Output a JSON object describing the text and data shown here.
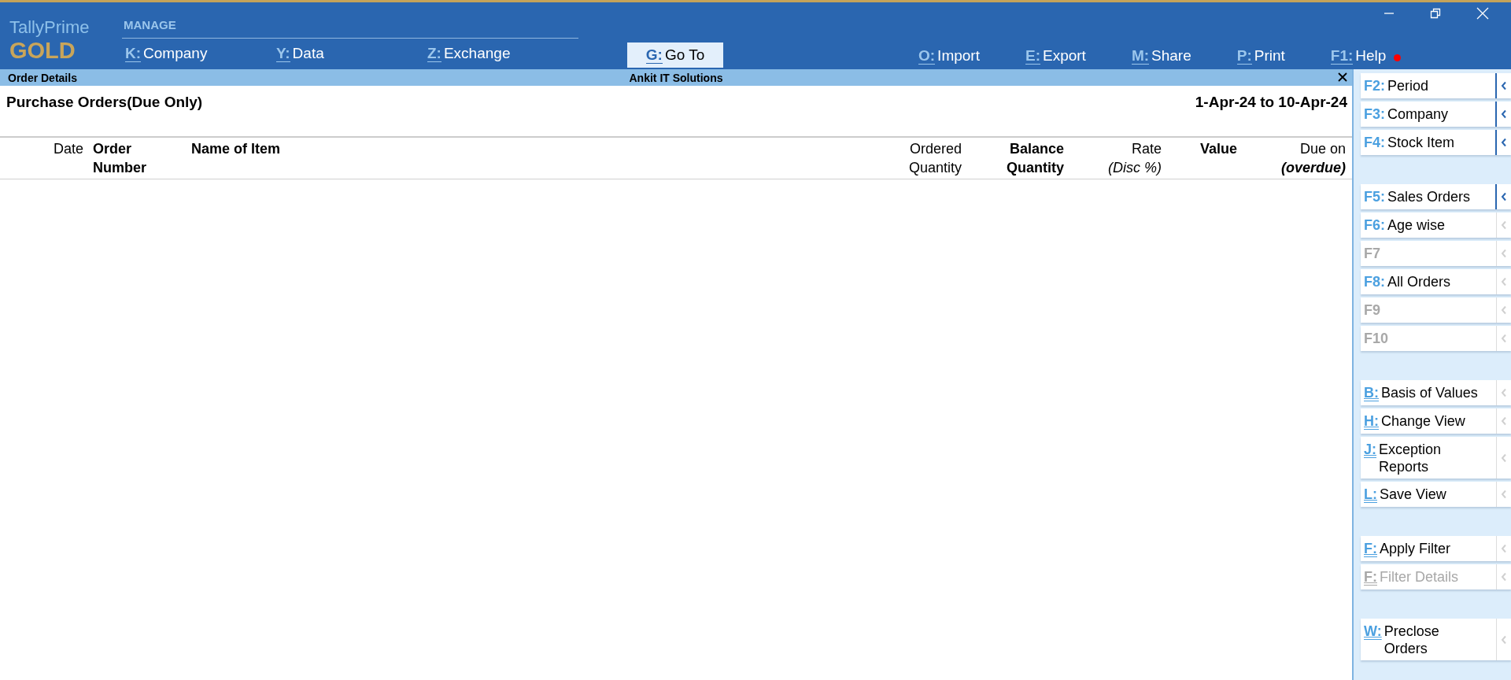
{
  "logo": {
    "product": "TallyPrime",
    "edition": "GOLD"
  },
  "manage": {
    "heading": "MANAGE",
    "items": [
      {
        "key": "K:",
        "label": "Company"
      },
      {
        "key": "Y:",
        "label": "Data"
      },
      {
        "key": "Z:",
        "label": "Exchange"
      }
    ]
  },
  "goto": {
    "key": "G:",
    "label": "Go To"
  },
  "actions": [
    {
      "key": "O:",
      "label": "Import",
      "alert": false
    },
    {
      "key": "E:",
      "label": "Export",
      "alert": false
    },
    {
      "key": "M:",
      "label": "Share",
      "alert": false
    },
    {
      "key": "P:",
      "label": "Print",
      "alert": false
    },
    {
      "key": "F1:",
      "label": "Help",
      "alert": true
    }
  ],
  "subtitle_bar": {
    "left": "Order Details",
    "center": "Ankit IT Solutions"
  },
  "report": {
    "title": "Purchase Orders(Due Only)",
    "period": "1-Apr-24 to 10-Apr-24"
  },
  "table": {
    "columns": [
      {
        "lines": [
          "Date"
        ]
      },
      {
        "lines": [
          "Order",
          "Number"
        ]
      },
      {
        "lines": [
          "Name of Item"
        ]
      },
      {
        "lines": [
          "Ordered",
          "Quantity"
        ]
      },
      {
        "lines": [
          "Balance",
          "Quantity"
        ]
      },
      {
        "lines": [
          "Rate",
          "*(Disc %)*"
        ]
      },
      {
        "lines": [
          "Value"
        ]
      },
      {
        "lines": [
          "Due on",
          "**(overdue)**"
        ]
      }
    ]
  },
  "sidebar": {
    "groups": [
      {
        "items": [
          {
            "key": "F2:",
            "label": "Period",
            "disabled": false,
            "underlined": false,
            "expandable": true
          },
          {
            "key": "F3:",
            "label": "Company",
            "disabled": false,
            "underlined": false,
            "expandable": true
          },
          {
            "key": "F4:",
            "label": "Stock Item",
            "disabled": false,
            "underlined": false,
            "expandable": true
          }
        ]
      },
      {
        "items": [
          {
            "key": "F5:",
            "label": "Sales Orders",
            "disabled": false,
            "underlined": false,
            "expandable": true
          },
          {
            "key": "F6:",
            "label": "Age wise",
            "disabled": false,
            "underlined": false,
            "expandable": false
          },
          {
            "key": "F7",
            "disabled": true,
            "underlined": false,
            "expandable": false
          },
          {
            "key": "F8:",
            "label": "All Orders",
            "disabled": false,
            "underlined": false,
            "expandable": false
          },
          {
            "key": "F9",
            "disabled": true,
            "underlined": false,
            "expandable": false
          },
          {
            "key": "F10",
            "disabled": true,
            "underlined": false,
            "expandable": false
          }
        ]
      },
      {
        "items": [
          {
            "key": "B:",
            "label": "Basis of Values",
            "disabled": false,
            "underlined": true,
            "expandable": false
          },
          {
            "key": "H:",
            "label": "Change View",
            "disabled": false,
            "underlined": true,
            "expandable": false
          },
          {
            "key": "J:",
            "label": "Exception Reports",
            "disabled": false,
            "underlined": true,
            "expandable": false
          },
          {
            "key": "L:",
            "label": "Save View",
            "disabled": false,
            "underlined": true,
            "expandable": false
          }
        ]
      },
      {
        "items": [
          {
            "key": "F:",
            "label": "Apply Filter",
            "disabled": false,
            "underlined": true,
            "expandable": false
          },
          {
            "key": "F:",
            "label": "Filter Details",
            "disabled": true,
            "underlined": true,
            "expandable": false
          }
        ]
      },
      {
        "items": [
          {
            "key": "W:",
            "label": "Preclose Orders",
            "disabled": false,
            "underlined": true,
            "expandable": false
          }
        ]
      }
    ]
  }
}
